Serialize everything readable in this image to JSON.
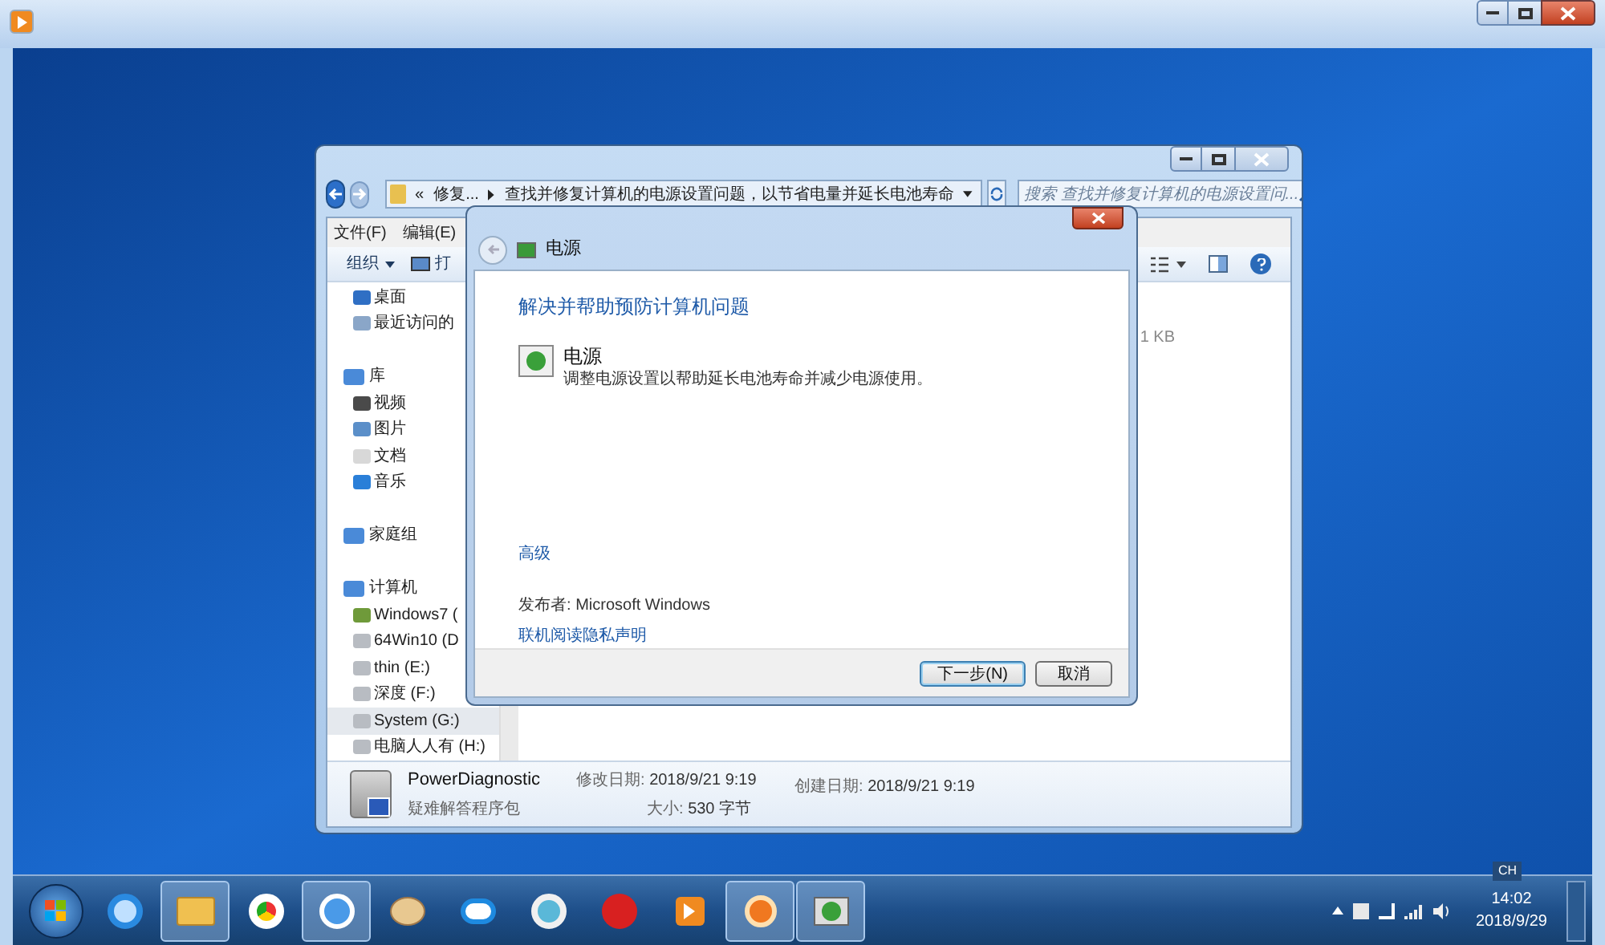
{
  "explorer": {
    "address": {
      "overflow": "«",
      "crumbs": [
        "修复...",
        "查找并修复计算机的电源设置问题，以节省电量并延长电池寿命"
      ]
    },
    "search": {
      "placeholder": "搜索 查找并修复计算机的电源设置问..."
    },
    "menu": [
      "文件(F)",
      "编辑(E)"
    ],
    "toolbar": {
      "organize": "组织",
      "open": "打"
    },
    "sidebar": [
      {
        "items": [
          {
            "label": "桌面",
            "selected": false
          },
          {
            "label": "最近访问的",
            "selected": false
          }
        ]
      },
      {
        "label": "库",
        "items": [
          {
            "label": "视频",
            "selected": false
          },
          {
            "label": "图片",
            "selected": false
          },
          {
            "label": "文档",
            "selected": false
          },
          {
            "label": "音乐",
            "selected": false
          }
        ]
      },
      {
        "label": "家庭组"
      },
      {
        "label": "计算机",
        "items": [
          {
            "label": "Windows7 (",
            "selected": false
          },
          {
            "label": "64Win10 (D",
            "selected": false
          },
          {
            "label": "thin (E:)",
            "selected": false
          },
          {
            "label": "深度 (F:)",
            "selected": false
          },
          {
            "label": "System (G:)",
            "selected": true
          },
          {
            "label": "电脑人人有 (H:)",
            "selected": false
          }
        ]
      }
    ],
    "file_size": "1 KB",
    "details": {
      "name": "PowerDiagnostic",
      "type": "疑难解答程序包",
      "modified": {
        "label": "修改日期:",
        "value": "2018/9/21 9:19"
      },
      "size": {
        "label": "大小:",
        "value": "530 字节"
      },
      "created": {
        "label": "创建日期:",
        "value": "2018/9/21 9:19"
      }
    }
  },
  "dialog": {
    "title": "电源",
    "heading": "解决并帮助预防计算机问题",
    "item": {
      "title": "电源",
      "description": "调整电源设置以帮助延长电池寿命并减少电源使用。"
    },
    "advanced_link": "高级",
    "publisher": {
      "label": "发布者:",
      "value": "Microsoft Windows"
    },
    "privacy_link": "联机阅读隐私声明",
    "buttons": [
      {
        "label": "下一步(N)",
        "default": true
      },
      {
        "label": "取消",
        "default": false
      }
    ]
  },
  "taskbar": {
    "apps": [
      {
        "selected": false
      },
      {
        "selected": true
      },
      {
        "selected": false
      },
      {
        "selected": true
      },
      {
        "selected": false
      },
      {
        "selected": false
      },
      {
        "selected": false
      },
      {
        "selected": false
      },
      {
        "selected": false
      },
      {
        "selected": true
      },
      {
        "selected": true
      }
    ]
  },
  "tray": {
    "language": "CH",
    "time": "14:02",
    "date": "2018/9/29"
  }
}
